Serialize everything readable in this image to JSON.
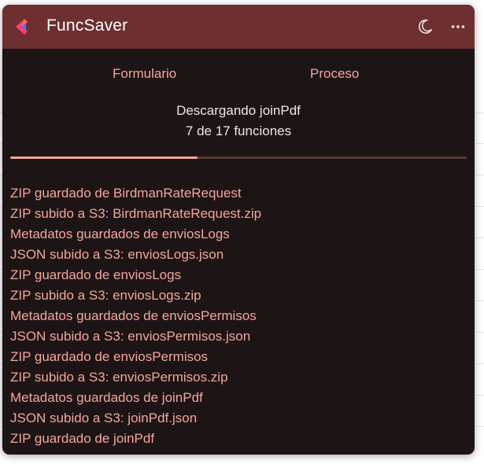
{
  "window": {
    "title": "FuncSaver",
    "icons": [
      "app-logo",
      "moon-icon",
      "more-icon"
    ]
  },
  "tabs": [
    {
      "label": "Formulario"
    },
    {
      "label": "Proceso"
    }
  ],
  "status": {
    "title": "Descargando joinPdf",
    "count": "7 de 17 funciones",
    "progress_percent": 41
  },
  "log": [
    "ZIP guardado de BirdmanRateRequest",
    "ZIP subido a S3: BirdmanRateRequest.zip",
    "Metadatos guardados de enviosLogs",
    "JSON subido a S3: enviosLogs.json",
    "ZIP guardado de enviosLogs",
    "ZIP subido a S3: enviosLogs.zip",
    "Metadatos guardados de enviosPermisos",
    "JSON subido a S3: enviosPermisos.json",
    "ZIP guardado de enviosPermisos",
    "ZIP subido a S3: enviosPermisos.zip",
    "Metadatos guardados de joinPdf",
    "JSON subido a S3: joinPdf.json",
    "ZIP guardado de joinPdf"
  ],
  "colors": {
    "titlebar": "#6e2f30",
    "background": "#1d1415",
    "accent": "#f2a79c",
    "text": "#f1e6e4"
  }
}
